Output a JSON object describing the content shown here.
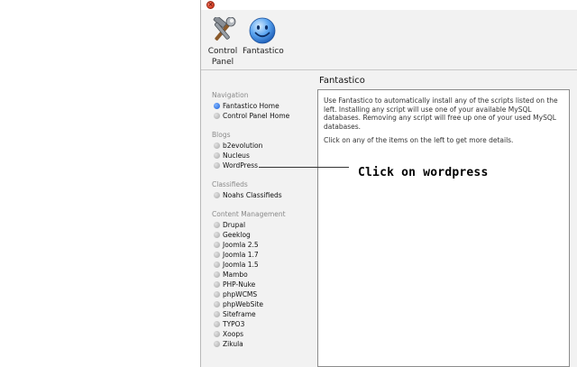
{
  "toolbar": {
    "control_panel_label_line1": "Control",
    "control_panel_label_line2": "Panel",
    "fantastico_label": "Fantastico",
    "control_panel_icon": "hammer-wrench-icon",
    "fantastico_icon": "smiley-icon"
  },
  "content_title": "Fantastico",
  "sidebar": {
    "navigation": {
      "heading": "Navigation",
      "items": [
        "Fantastico Home",
        "Control Panel Home"
      ]
    },
    "blogs": {
      "heading": "Blogs",
      "items": [
        "b2evolution",
        "Nucleus",
        "WordPress"
      ]
    },
    "classifieds": {
      "heading": "Classifieds",
      "items": [
        "Noahs Classifieds"
      ]
    },
    "content_management": {
      "heading": "Content Management",
      "items": [
        "Drupal",
        "Geeklog",
        "Joomla 2.5",
        "Joomla 1.7",
        "Joomla 1.5",
        "Mambo",
        "PHP-Nuke",
        "phpWCMS",
        "phpWebSite",
        "Siteframe",
        "TYPO3",
        "Xoops",
        "Zikula"
      ]
    }
  },
  "panel": {
    "description": "Use Fantastico to automatically install any of the scripts listed on the left. Installing any script will use one of your available MySQL databases. Removing any script will free up one of your used MySQL databases.",
    "instruction": "Click on any of the items on the left to get more details."
  },
  "annotation": {
    "callout_text": "Click on wordpress"
  },
  "colors": {
    "window_bg": "#f2f2f2",
    "section_heading": "#8a8a8a",
    "selected_bullet": "#1b5fd6",
    "close_button": "#d43a1f"
  }
}
